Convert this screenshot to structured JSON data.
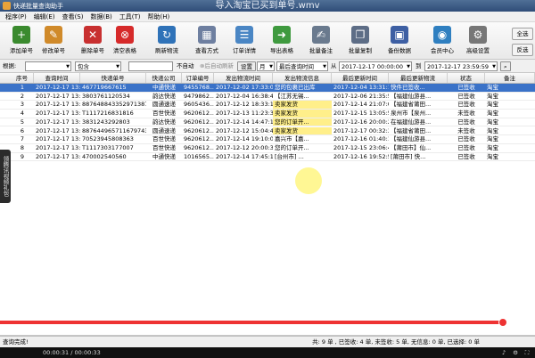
{
  "window": {
    "title": "快递批量查询助手",
    "video_title": "导入淘宝已买到单号.wmv"
  },
  "menu": [
    "程序(P)",
    "编辑(E)",
    "查看(S)",
    "数据(B)",
    "工具(T)",
    "帮助(H)"
  ],
  "toolbar": [
    {
      "id": "add-order",
      "label": "添加单号",
      "icon": "plus-icon",
      "color": "#3a8a2e"
    },
    {
      "id": "edit-order",
      "label": "修改单号",
      "icon": "pencil-icon",
      "color": "#d08a2a"
    },
    {
      "id": "delete-order",
      "label": "删除单号",
      "icon": "x-icon",
      "color": "#c83030"
    },
    {
      "id": "clear-table",
      "label": "清空表格",
      "icon": "stop-icon",
      "color": "#d62a2a"
    },
    {
      "id": "refresh-logistics",
      "label": "刷新物流",
      "icon": "refresh-icon",
      "color": "#2f72b8"
    },
    {
      "id": "view-mode",
      "label": "查看方式",
      "icon": "view-icon",
      "color": "#6e7fa0"
    },
    {
      "id": "order-detail",
      "label": "订单详情",
      "icon": "document-icon",
      "color": "#4a86c4"
    },
    {
      "id": "export-table",
      "label": "导出表格",
      "icon": "export-icon",
      "color": "#3f9a3f"
    },
    {
      "id": "batch-remark",
      "label": "批量备注",
      "icon": "note-icon",
      "color": "#6a7a8e"
    },
    {
      "id": "batch-copy",
      "label": "批量复制",
      "icon": "copy-icon",
      "color": "#5d6d86"
    },
    {
      "id": "backup-data",
      "label": "备份数据",
      "icon": "disk-icon",
      "color": "#3d5fa3"
    },
    {
      "id": "member-center",
      "label": "会员中心",
      "icon": "globe-icon",
      "color": "#2f7fc0"
    },
    {
      "id": "advanced-settings",
      "label": "高级设置",
      "icon": "gear-icon",
      "color": "#777777"
    }
  ],
  "right_buttons": [
    "全选",
    "反选"
  ],
  "filter": {
    "label": "根据:",
    "field_value": "",
    "match_value": "包含",
    "auto_stop": "不自动",
    "auto_refresh": "⊗后自动刷新",
    "settings": "设置",
    "unit_value": "月",
    "sort_field": "最后查询时间",
    "from_label": "从",
    "from_time": "2017-12-17 00:00:00",
    "to_label": "到",
    "to_time": "2017-12-17 23:59:59"
  },
  "columns": [
    "序号",
    "查询时间",
    "快递单号",
    "快递公司",
    "订单编号",
    "发出物流时间",
    "发出物流信息",
    "最后更新时间",
    "最后更新物流",
    "状态",
    "备注"
  ],
  "rows": [
    [
      "1",
      "2017-12-17 13:51:40",
      "467719667615",
      "中通快递",
      "9455768...",
      "2017-12-02 17:33:05",
      "您的包裹已出库",
      "2017-12-04 13:31:10",
      "快件已签收...",
      "已签收",
      "淘宝"
    ],
    [
      "2",
      "2017-12-17 13:51:40",
      "3803761120534",
      "韵达快递",
      "9479862...",
      "2017-12-04 16:38:44",
      "【江苏无锡...",
      "2017-12-06 21:35:51",
      "【福建仙游县...",
      "已签收",
      "淘宝"
    ],
    [
      "3",
      "2017-12-17 13:51:39",
      "887648843352971387",
      "圆通速递",
      "9605436...",
      "2017-12-12 18:33:14",
      "卖家发货",
      "2017-12-14 21:07:09",
      "【福建省莆田...",
      "已签收",
      "淘宝"
    ],
    [
      "4",
      "2017-12-17 13:51:38",
      "T1117216831816",
      "百世快递",
      "9620612...",
      "2017-12-13 11:23:38",
      "卖家发货",
      "2017-12-15 13:05:55",
      "泉州市【泉州...",
      "未签收",
      "淘宝"
    ],
    [
      "5",
      "2017-12-17 13:51:38",
      "3831243292803",
      "韵达快递",
      "9620612...",
      "2017-12-14 14:47:13",
      "您的订单开...",
      "2017-12-16 20:00:24",
      "在福建仙游县...",
      "已签收",
      "淘宝"
    ],
    [
      "6",
      "2017-12-17 13:51:37",
      "887644965711679743",
      "圆通速递",
      "9620612...",
      "2017-12-12 15:04:46",
      "卖家发货",
      "2017-12-17 00:32:39",
      "【福建省莆田...",
      "未签收",
      "淘宝"
    ],
    [
      "7",
      "2017-12-17 13:51:48",
      "70523945808363",
      "百世快递",
      "9620612...",
      "2017-12-14 19:10:00",
      "嘉兴市【嘉...",
      "2017-12-16 01:40:16",
      "【福建仙游县...",
      "已签收",
      "淘宝"
    ],
    [
      "8",
      "2017-12-17 13:51:48",
      "T1117303177007",
      "百世快递",
      "9620612...",
      "2017-12-12 20:00:34",
      "您的订单开...",
      "2017-12-15 23:06:45",
      "【莆田市】仙...",
      "已签收",
      "淘宝"
    ],
    [
      "9",
      "2017-12-17 13:51:47",
      "470002540560",
      "中通快递",
      "1016565...",
      "2017-12-14 17:45:17",
      "[台州市] ...",
      "2017-12-16 19:52:54",
      "[莆田市] 快...",
      "已签收",
      "淘宝"
    ]
  ],
  "side_tab": "领腾讯视频礼包",
  "status": {
    "left": "查询完成!",
    "summary": "共: 9 单 , 已签收: 4 单, 未签收: 5 单, 无信息: 0 单, 已选择: 0 单"
  },
  "video": {
    "time": "00:00:31 / 00:00:33",
    "progress": 0.94
  }
}
